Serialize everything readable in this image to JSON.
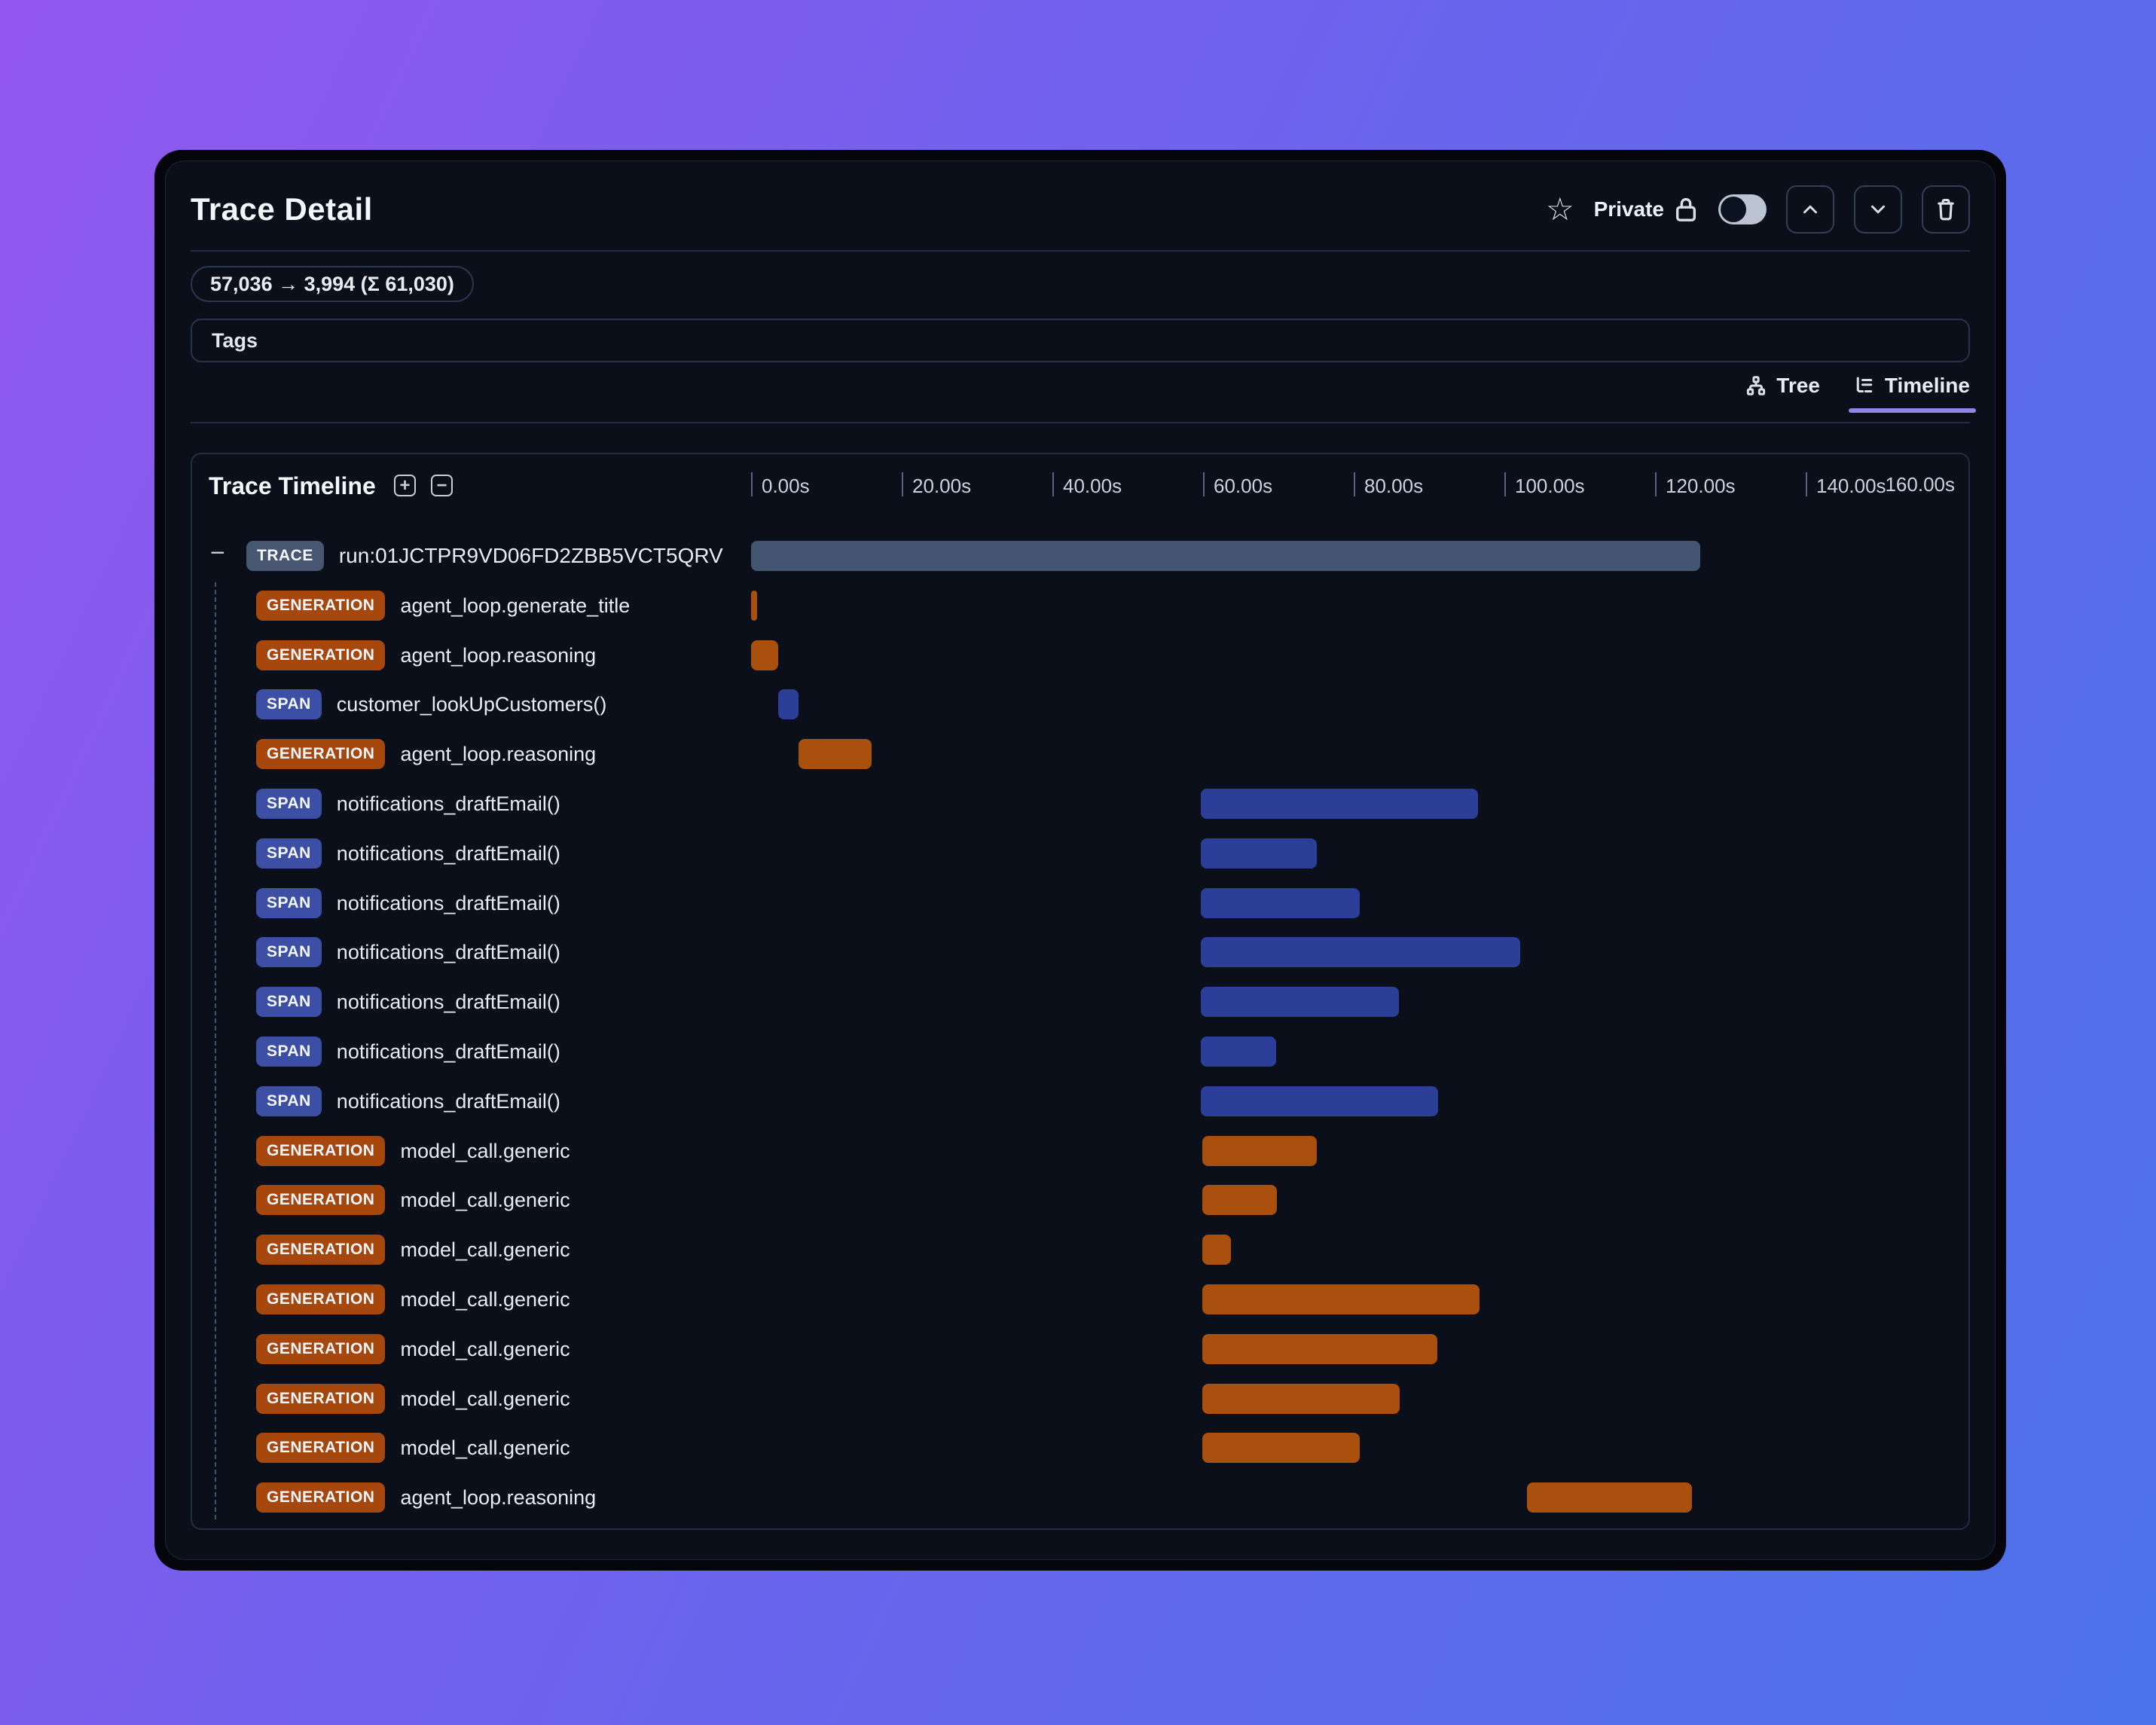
{
  "header": {
    "title": "Trace Detail",
    "star_icon": "star-outline",
    "privacy_label": "Private",
    "lock_icon": "padlock-outline",
    "privacy_toggle_state": "off",
    "buttons": [
      "chevron-up",
      "chevron-down",
      "trash"
    ]
  },
  "token_badge": "57,036 → 3,994 (Σ 61,030)",
  "tags": {
    "label": "Tags"
  },
  "view_tabs": [
    {
      "label": "Tree",
      "icon": "tree-icon",
      "active": false
    },
    {
      "label": "Timeline",
      "icon": "timeline-icon",
      "active": true
    }
  ],
  "timeline_panel": {
    "title": "Trace Timeline",
    "zoom_in_label": "+",
    "zoom_out_label": "−",
    "collapse_glyph": "−"
  },
  "chart_data": {
    "type": "timeline",
    "title": "Trace Timeline",
    "axis": {
      "min_s": 0,
      "max_s": 160,
      "tick_interval_s": 20,
      "tick_labels": [
        "0.00s",
        "20.00s",
        "40.00s",
        "60.00s",
        "80.00s",
        "100.00s",
        "120.00s",
        "140.00s"
      ],
      "end_label": "160.00s",
      "unit": "seconds"
    },
    "type_colors": {
      "TRACE": {
        "badge": "#475671",
        "bar": "#445571"
      },
      "GENERATION": {
        "badge": "#a6470e",
        "bar": "#a9500f"
      },
      "SPAN": {
        "badge": "#3c4fa5",
        "bar": "#2c3f98"
      }
    },
    "rows": [
      {
        "type": "TRACE",
        "name": "run:01JCTPR9VD06FD2ZBB5VCT5QRV",
        "start_s": 0,
        "end_s": 126.0
      },
      {
        "type": "GENERATION",
        "name": "agent_loop.generate_title",
        "start_s": 0,
        "end_s": 0.8
      },
      {
        "type": "GENERATION",
        "name": "agent_loop.reasoning",
        "start_s": 0,
        "end_s": 3.6
      },
      {
        "type": "SPAN",
        "name": "customer_lookUpCustomers()",
        "start_s": 3.6,
        "end_s": 6.3
      },
      {
        "type": "GENERATION",
        "name": "agent_loop.reasoning",
        "start_s": 6.3,
        "end_s": 16.0
      },
      {
        "type": "SPAN",
        "name": "notifications_draftEmail()",
        "start_s": 59.7,
        "end_s": 96.5
      },
      {
        "type": "SPAN",
        "name": "notifications_draftEmail()",
        "start_s": 59.7,
        "end_s": 75.1
      },
      {
        "type": "SPAN",
        "name": "notifications_draftEmail()",
        "start_s": 59.7,
        "end_s": 80.8
      },
      {
        "type": "SPAN",
        "name": "notifications_draftEmail()",
        "start_s": 59.7,
        "end_s": 102.1
      },
      {
        "type": "SPAN",
        "name": "notifications_draftEmail()",
        "start_s": 59.7,
        "end_s": 86.0
      },
      {
        "type": "SPAN",
        "name": "notifications_draftEmail()",
        "start_s": 59.7,
        "end_s": 69.7
      },
      {
        "type": "SPAN",
        "name": "notifications_draftEmail()",
        "start_s": 59.7,
        "end_s": 91.2
      },
      {
        "type": "GENERATION",
        "name": "model_call.generic",
        "start_s": 59.9,
        "end_s": 75.1
      },
      {
        "type": "GENERATION",
        "name": "model_call.generic",
        "start_s": 59.9,
        "end_s": 69.8
      },
      {
        "type": "GENERATION",
        "name": "model_call.generic",
        "start_s": 59.9,
        "end_s": 63.7
      },
      {
        "type": "GENERATION",
        "name": "model_call.generic",
        "start_s": 59.9,
        "end_s": 96.7
      },
      {
        "type": "GENERATION",
        "name": "model_call.generic",
        "start_s": 59.9,
        "end_s": 91.1
      },
      {
        "type": "GENERATION",
        "name": "model_call.generic",
        "start_s": 59.9,
        "end_s": 86.1
      },
      {
        "type": "GENERATION",
        "name": "model_call.generic",
        "start_s": 59.9,
        "end_s": 80.8
      },
      {
        "type": "GENERATION",
        "name": "agent_loop.reasoning",
        "start_s": 103.0,
        "end_s": 124.9
      }
    ]
  }
}
